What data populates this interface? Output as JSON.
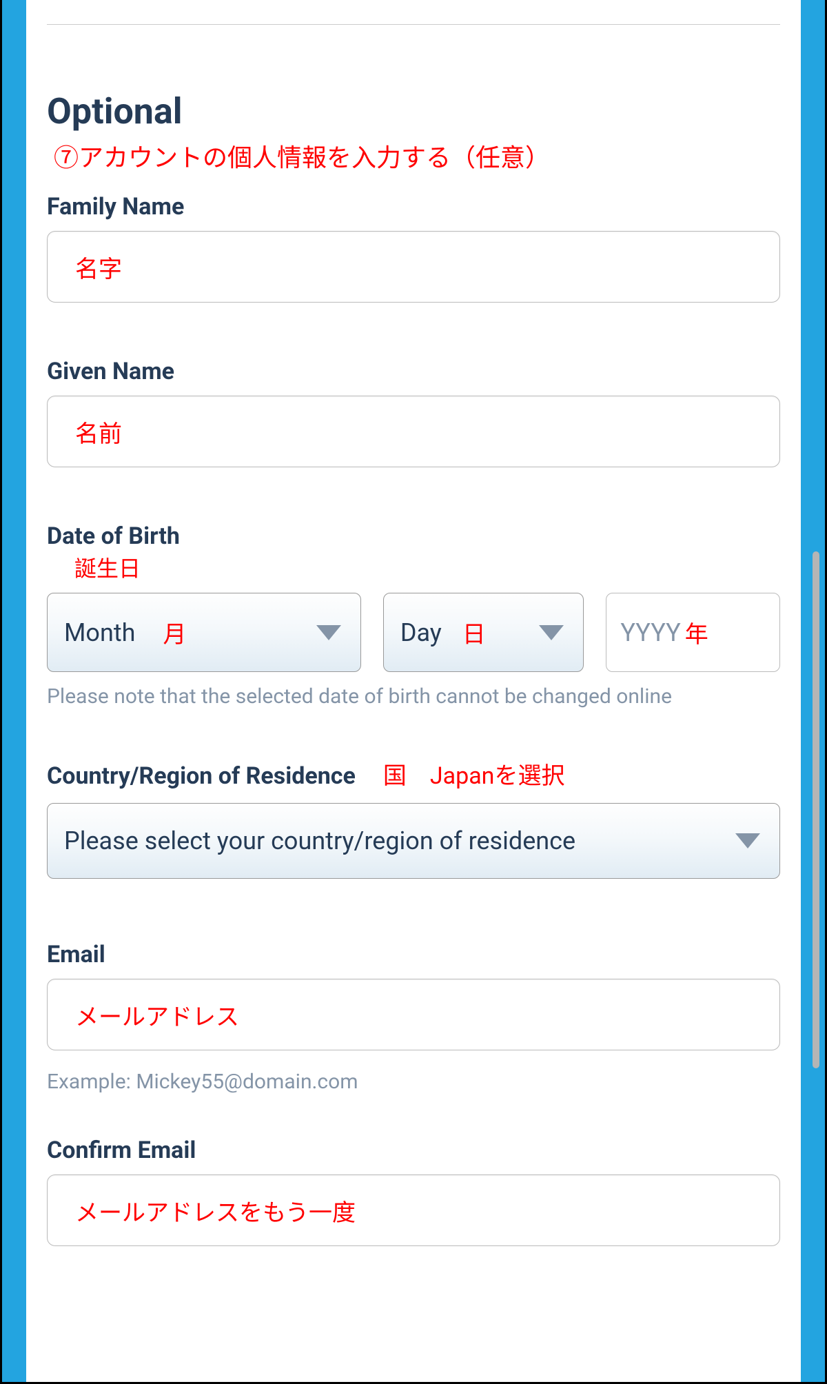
{
  "section": {
    "title": "Optional",
    "annotation": "⑦アカウントの個人情報を入力する（任意）"
  },
  "familyName": {
    "label": "Family Name",
    "hint": "名字"
  },
  "givenName": {
    "label": "Given Name",
    "hint": "名前"
  },
  "dob": {
    "label": "Date of Birth",
    "annotation": "誕生日",
    "month": {
      "placeholder": "Month",
      "hint": "月"
    },
    "day": {
      "placeholder": "Day",
      "hint": "日"
    },
    "year": {
      "placeholder": "YYYY",
      "hint": "年"
    },
    "helper": "Please note that the selected date of birth cannot be changed online"
  },
  "country": {
    "label": "Country/Region of Residence",
    "annotation": "国　Japanを選択",
    "placeholder": "Please select your country/region of residence"
  },
  "email": {
    "label": "Email",
    "hint": "メールアドレス",
    "helper": "Example: Mickey55@domain.com"
  },
  "confirmEmail": {
    "label": "Confirm Email",
    "hint": "メールアドレスをもう一度"
  }
}
